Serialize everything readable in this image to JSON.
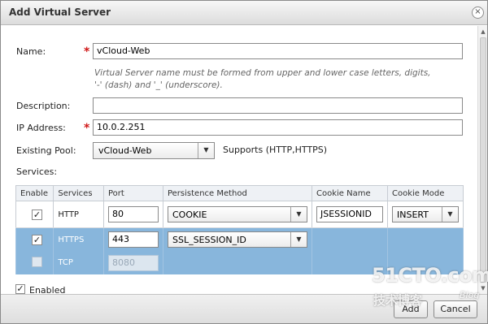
{
  "window": {
    "title": "Add Virtual Server",
    "close_glyph": "×"
  },
  "form": {
    "name_label": "Name:",
    "name_value": "vCloud-Web",
    "required_mark": "*",
    "name_hint_line1": "Virtual Server name must be formed from upper and lower case letters, digits,",
    "name_hint_line2": "'-' (dash) and '_' (underscore).",
    "description_label": "Description:",
    "description_value": "",
    "ip_label": "IP Address:",
    "ip_value": "10.0.2.251",
    "pool_label": "Existing Pool:",
    "pool_value": "vCloud-Web",
    "pool_supports": "Supports (HTTP,HTTPS)",
    "services_label": "Services:"
  },
  "services_table": {
    "headers": [
      "Enable",
      "Services",
      "Port",
      "Persistence Method",
      "Cookie Name",
      "Cookie Mode"
    ],
    "rows": [
      {
        "enabled": true,
        "service": "HTTP",
        "port": "80",
        "persistence": "COOKIE",
        "cookie_name": "JSESSIONID",
        "cookie_mode": "INSERT"
      },
      {
        "enabled": true,
        "service": "HTTPS",
        "port": "443",
        "persistence": "SSL_SESSION_ID",
        "cookie_name": "",
        "cookie_mode": ""
      },
      {
        "enabled": false,
        "service": "TCP",
        "port": "8080",
        "persistence": "",
        "cookie_name": "",
        "cookie_mode": ""
      }
    ]
  },
  "enabled_checkbox": {
    "label": "Enabled",
    "checked": true
  },
  "buttons": {
    "add": "Add",
    "cancel": "Cancel"
  },
  "watermark": {
    "site": "51CTO.com",
    "tagline": "技术博客",
    "blog": "Blog"
  },
  "icons": {
    "check": "✓",
    "dropdown": "▼",
    "scroll_up": "▲",
    "scroll_down": "▼"
  },
  "colors": {
    "selected_row": "#88b6dc",
    "required": "#d01818"
  }
}
